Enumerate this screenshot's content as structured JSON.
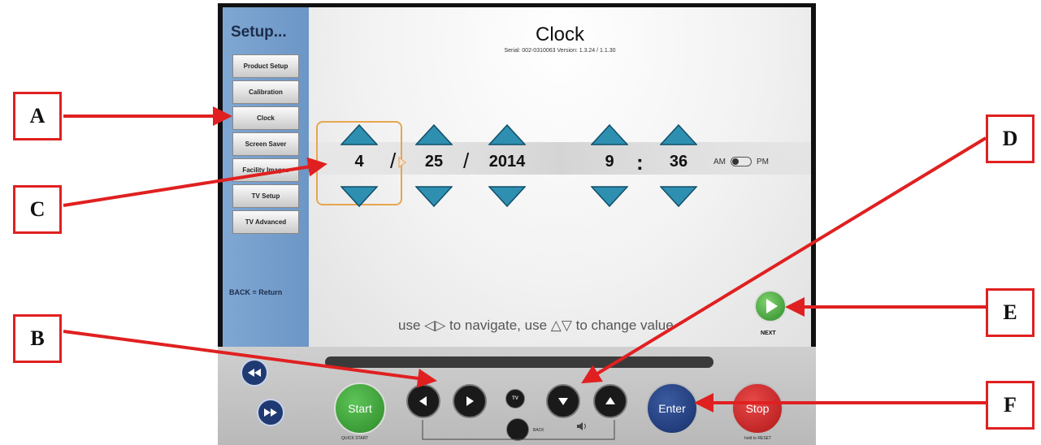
{
  "sidebar": {
    "title": "Setup...",
    "items": [
      {
        "label": "Product Setup"
      },
      {
        "label": "Calibration"
      },
      {
        "label": "Clock"
      },
      {
        "label": "Screen Saver"
      },
      {
        "label": "Facility Images"
      },
      {
        "label": "TV Setup"
      },
      {
        "label": "TV Advanced"
      }
    ],
    "back_hint": "BACK = Return"
  },
  "clock": {
    "title": "Clock",
    "serial_line": "Serial: 002-0310063   Version: 1.3.24 / 1.1.30",
    "month": "4",
    "day": "25",
    "year": "2014",
    "hour": "9",
    "minute": "36",
    "date_separator": "/",
    "time_separator": ":",
    "am_label": "AM",
    "pm_label": "PM",
    "hint": "use ◁▷ to navigate, use △▽ to change value",
    "next_label": "NEXT"
  },
  "console": {
    "start_label": "Start",
    "quick_start_label": "QUICK START",
    "back_label": "BACK",
    "tv_label": "TV",
    "enter_label": "Enter",
    "stop_label": "Stop",
    "hold_reset_label": "hold to RESET"
  },
  "callouts": [
    "A",
    "B",
    "C",
    "D",
    "E",
    "F"
  ],
  "colors": {
    "sidebar": "#7fa7d3",
    "arrow_button": "#2f8fb1",
    "start": "#3aa635",
    "enter": "#1f3a73",
    "stop": "#cc2222",
    "callout": "#e02020",
    "focus": "#e7a64e"
  }
}
